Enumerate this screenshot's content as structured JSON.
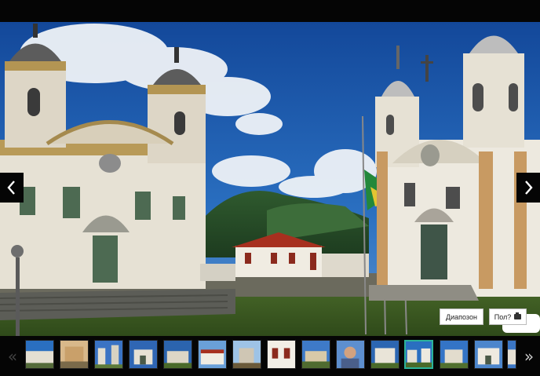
{
  "viewer": {
    "prev_icon": "chevron-left-icon",
    "next_icon": "chevron-right-icon"
  },
  "controls": {
    "slideshow_label": "Диапозон",
    "fullscreen_label": "Пол?",
    "fullscreen_icon": "camera-icon"
  },
  "thumbnails": {
    "count": 15,
    "active_index": 11,
    "prev_icon": "double-chevron-left-icon",
    "next_icon": "double-chevron-right-icon"
  },
  "colors": {
    "background": "#000000",
    "active_thumb_border": "#2bb39a",
    "sky": "#1c5aa8"
  }
}
